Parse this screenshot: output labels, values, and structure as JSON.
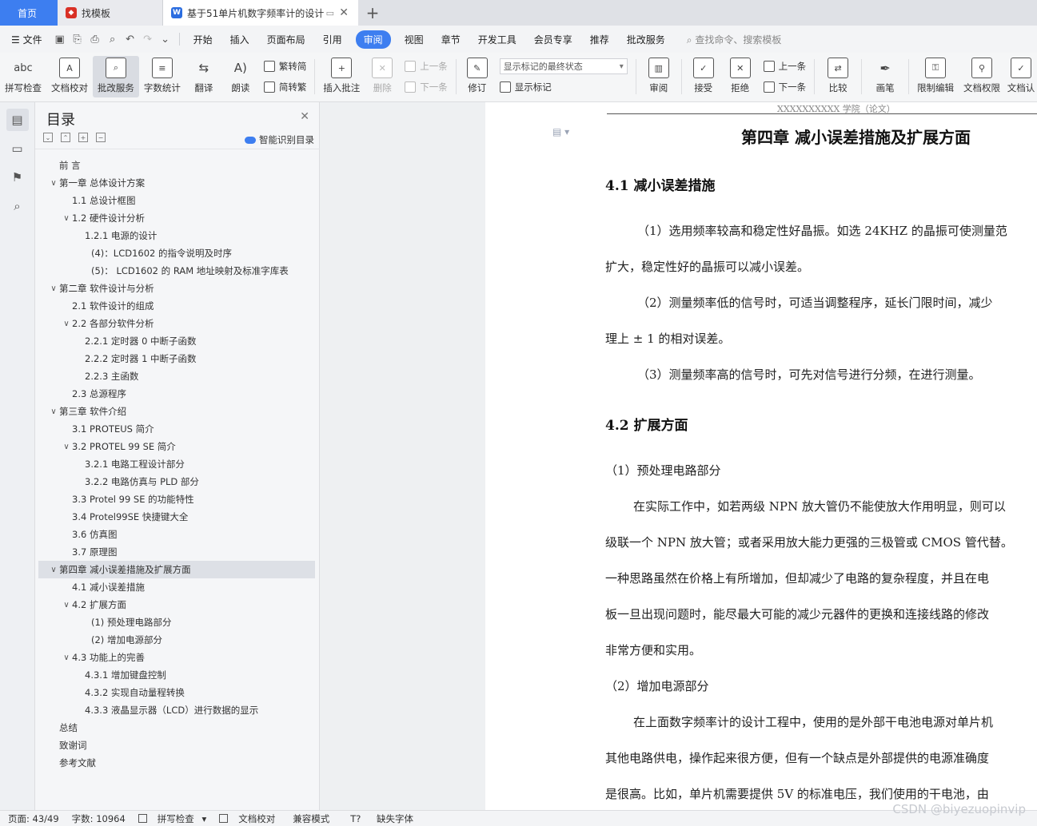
{
  "tabs": {
    "home": "首页",
    "template": "找模板",
    "doc": "基于51单片机数字频率计的设计",
    "add": "+"
  },
  "menu": {
    "file": "文件",
    "items": [
      "开始",
      "插入",
      "页面布局",
      "引用",
      "审阅",
      "视图",
      "章节",
      "开发工具",
      "会员专享",
      "推荐",
      "批改服务"
    ],
    "active": "审阅",
    "search": "查找命令、搜索模板"
  },
  "ribbon": {
    "spell": "拼写检查",
    "proof": "文档校对",
    "grading": "批改服务",
    "wordcount": "字数统计",
    "translate": "翻译",
    "read": "朗读",
    "trad": "繁转简",
    "simp": "简转繁",
    "insert_comment": "插入批注",
    "delete": "删除",
    "prev_comment": "上一条",
    "next_comment": "下一条",
    "revise": "修订",
    "markup_state": "显示标记的最终状态",
    "show_markup": "显示标记",
    "review": "审阅",
    "accept": "接受",
    "reject": "拒绝",
    "prev_change": "上一条",
    "next_change": "下一条",
    "compare": "比较",
    "pen": "画笔",
    "restrict": "限制编辑",
    "rights": "文档权限",
    "cert": "文档认"
  },
  "toc": {
    "title": "目录",
    "smart": "智能识别目录",
    "items": [
      {
        "text": "前    言",
        "level": 0,
        "chev": ""
      },
      {
        "text": "第一章    总体设计方案",
        "level": 0,
        "chev": "v"
      },
      {
        "text": "1.1  总设计框图",
        "level": 1,
        "chev": ""
      },
      {
        "text": "1.2  硬件设计分析",
        "level": 1,
        "chev": "v"
      },
      {
        "text": "1.2.1  电源的设计",
        "level": 2,
        "chev": ""
      },
      {
        "text": "(4)：LCD1602 的指令说明及时序",
        "level": 3,
        "chev": ""
      },
      {
        "text": "(5)：  LCD1602 的 RAM 地址映射及标准字库表",
        "level": 3,
        "chev": ""
      },
      {
        "text": "第二章    软件设计与分析",
        "level": 0,
        "chev": "v"
      },
      {
        "text": "2.1  软件设计的组成",
        "level": 1,
        "chev": ""
      },
      {
        "text": "2.2    各部分软件分析",
        "level": 1,
        "chev": "v"
      },
      {
        "text": "2.2.1    定时器 0 中断子函数",
        "level": 2,
        "chev": ""
      },
      {
        "text": "2.2.2    定时器 1 中断子函数",
        "level": 2,
        "chev": ""
      },
      {
        "text": "2.2.3    主函数",
        "level": 2,
        "chev": ""
      },
      {
        "text": "2.3    总源程序",
        "level": 1,
        "chev": ""
      },
      {
        "text": "第三章    软件介绍",
        "level": 0,
        "chev": "v"
      },
      {
        "text": "3.1 PROTEUS 简介",
        "level": 1,
        "chev": ""
      },
      {
        "text": "3.2 PROTEL 99 SE 简介",
        "level": 1,
        "chev": "v"
      },
      {
        "text": "3.2.1  电路工程设计部分",
        "level": 2,
        "chev": ""
      },
      {
        "text": "3.2.2  电路仿真与 PLD 部分",
        "level": 2,
        "chev": ""
      },
      {
        "text": "3.3 Protel 99 SE 的功能特性",
        "level": 1,
        "chev": ""
      },
      {
        "text": "3.4 Protel99SE 快捷键大全",
        "level": 1,
        "chev": ""
      },
      {
        "text": "3.6 仿真图",
        "level": 1,
        "chev": ""
      },
      {
        "text": "3.7 原理图",
        "level": 1,
        "chev": ""
      },
      {
        "text": "第四章    减小误差措施及扩展方面",
        "level": 0,
        "chev": "v",
        "selected": true
      },
      {
        "text": "4.1 减小误差措施",
        "level": 1,
        "chev": ""
      },
      {
        "text": "4.2 扩展方面",
        "level": 1,
        "chev": "v"
      },
      {
        "text": "(1)  预处理电路部分",
        "level": 3,
        "chev": ""
      },
      {
        "text": "(2)  增加电源部分",
        "level": 3,
        "chev": ""
      },
      {
        "text": "4.3  功能上的完善",
        "level": 1,
        "chev": "v"
      },
      {
        "text": "4.3.1  增加键盘控制",
        "level": 2,
        "chev": ""
      },
      {
        "text": "4.3.2  实现自动量程转换",
        "level": 2,
        "chev": ""
      },
      {
        "text": "4.3.3  液晶显示器（LCD）进行数据的显示",
        "level": 2,
        "chev": ""
      },
      {
        "text": "总结",
        "level": 0,
        "chev": ""
      },
      {
        "text": "致谢词",
        "level": 0,
        "chev": ""
      },
      {
        "text": "参考文献",
        "level": 0,
        "chev": ""
      }
    ]
  },
  "document": {
    "header": "XXXXXXXXXX 学院（论文）",
    "chapter": "第四章   减小误差措施及扩展方面",
    "h41": "4.1 减小误差措施",
    "p1a": "（1）选用频率较高和稳定性好晶振。如选 24KHZ 的晶振可使测量范",
    "p1b": "扩大，稳定性好的晶振可以减小误差。",
    "p2a": "（2）测量频率低的信号时，可适当调整程序，延长门限时间，减少",
    "p2b": "理上 ± 1 的相对误差。",
    "p3": "（3）测量频率高的信号时，可先对信号进行分频，在进行测量。",
    "h42": "4.2 扩展方面",
    "s1": "（1）预处理电路部分",
    "p4a": "在实际工作中，如若两级 NPN 放大管仍不能使放大作用明显，则可以",
    "p4b": "级联一个 NPN 放大管；或者采用放大能力更强的三极管或 CMOS 管代替。",
    "p4c": "一种思路虽然在价格上有所增加，但却减少了电路的复杂程度，并且在电",
    "p4d": "板一旦出现问题时，能尽最大可能的减少元器件的更换和连接线路的修改",
    "p4e": "非常方便和实用。",
    "s2": "（2）增加电源部分",
    "p5a": "在上面数字频率计的设计工程中，使用的是外部干电池电源对单片机",
    "p5b": "其他电路供电，操作起来很方便，但有一个缺点是外部提供的电源准确度",
    "p5c": "是很高。比如，单片机需要提供 5V 的标准电压，我们使用的干电池，由"
  },
  "status": {
    "page": "页面: 43/49",
    "words": "字数: 10964",
    "spell": "拼写检查",
    "proof": "文档校对",
    "compat": "兼容模式",
    "missing_font": "缺失字体"
  },
  "watermark": "CSDN @biyezuopinvip",
  "colors": {
    "accent": "#3d7ef0",
    "tab_template_icon": "#d93025",
    "tab_doc_icon": "#2b6de0"
  }
}
